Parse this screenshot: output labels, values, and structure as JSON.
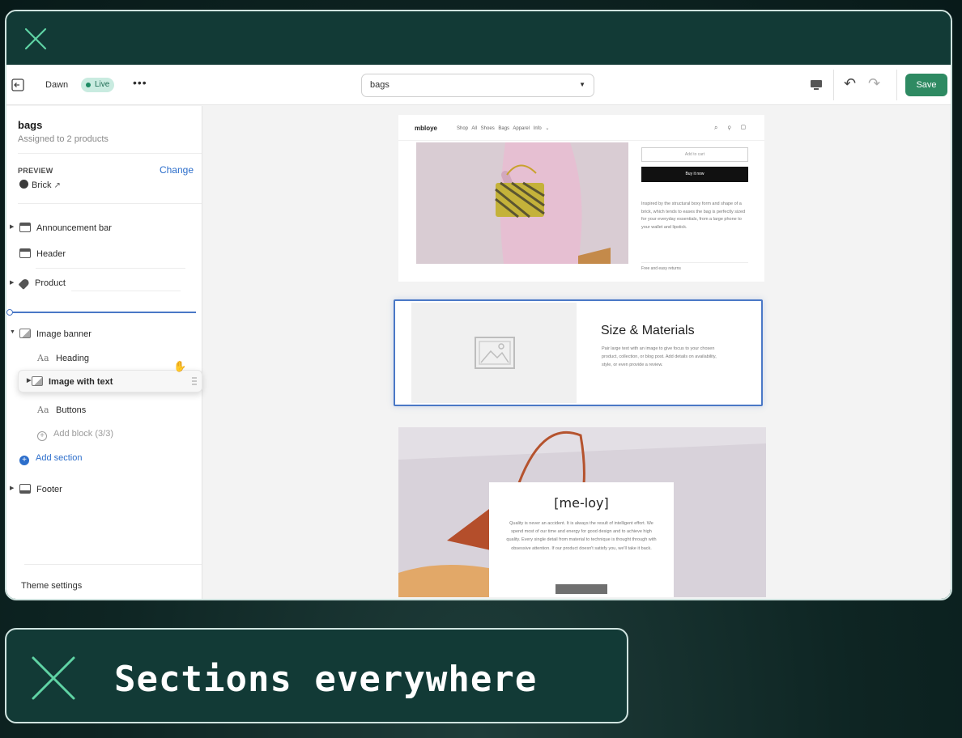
{
  "toolbar": {
    "theme_name": "Dawn",
    "live_badge": "Live",
    "more": "•••",
    "template_select": "bags",
    "save_label": "Save"
  },
  "sidebar": {
    "title": "bags",
    "subtitle": "Assigned to 2 products",
    "preview_label": "PREVIEW",
    "change_label": "Change",
    "preview_product": "Brick",
    "sections": {
      "announcement_bar": "Announcement bar",
      "header": "Header",
      "product": "Product",
      "image_banner": "Image banner",
      "heading": "Heading",
      "image_with_text": "Image with text",
      "buttons": "Buttons",
      "add_block": "Add block (3/3)",
      "add_section": "Add section",
      "footer": "Footer"
    },
    "theme_settings": "Theme settings"
  },
  "preview": {
    "store_logo": "mbloye",
    "nav_links": "Shop All  Shoes  Bags  Apparel  Info ⌄",
    "add_to_cart": "Add to cart",
    "buy_now": "Buy it now",
    "description": "Inspired by the structural boxy form and shape of a brick, which tends to eases the bag is perfectly sized for your everyday essentials, from a large phone to your wallet and lipstick.",
    "shipping": "Free and easy returns",
    "banner_title": "Size & Materials",
    "banner_text": "Pair large text with an image to give focus to your chosen product, collection, or blog post. Add details on availability, style, or even provide a review.",
    "lifestyle_title": "[me-loy]",
    "lifestyle_text": "Quality is never an accident. It is always the result of intelligent effort. We spend most of our time and energy for good design and to achieve high quality. Every single detail from material to technique is thought through with obsessive attention. If our product doesn't satisfy you, we'll take it back."
  },
  "caption": {
    "text": "Sections everywhere"
  },
  "colors": {
    "brand_dark": "#123a36",
    "accent_green": "#2e8a62",
    "selection_blue": "#4a78c6"
  }
}
